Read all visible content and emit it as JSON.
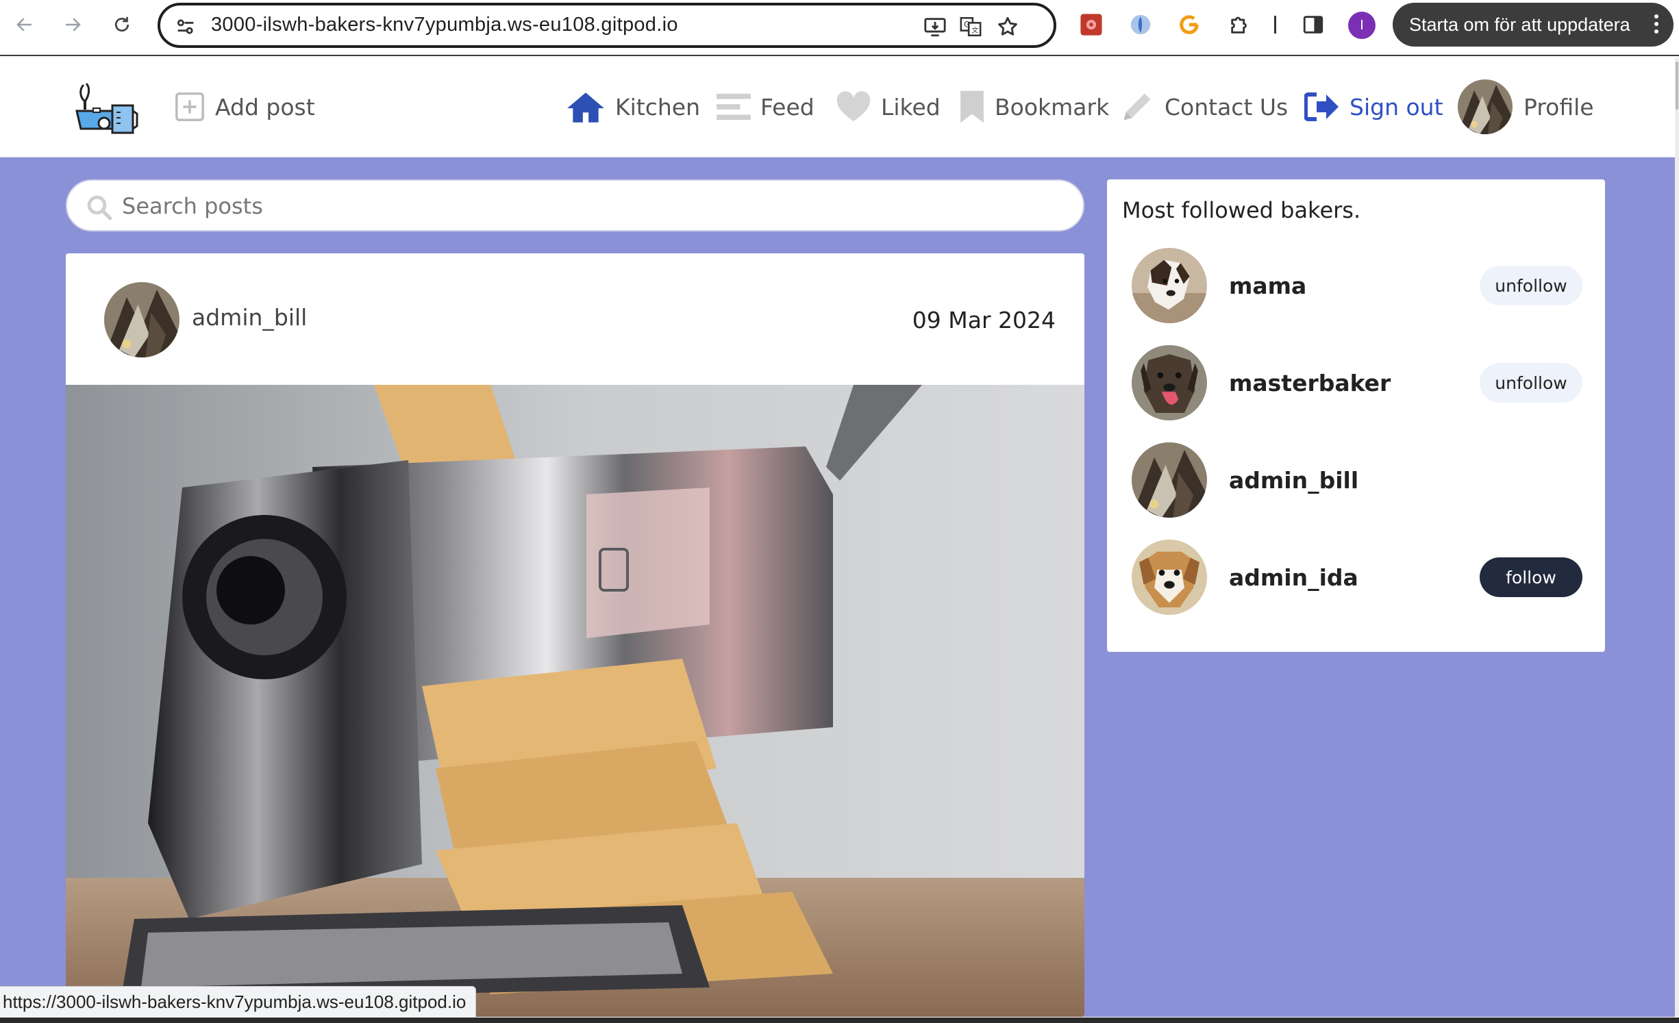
{
  "browser": {
    "url": "3000-ilswh-bakers-knv7ypumbja.ws-eu108.gitpod.io",
    "profile_initial": "I",
    "update_label": "Starta om för att uppdatera",
    "status_url": "https://3000-ilswh-bakers-knv7ypumbja.ws-eu108.gitpod.io"
  },
  "header": {
    "add_post": "Add post",
    "nav": {
      "kitchen": "Kitchen",
      "feed": "Feed",
      "liked": "Liked",
      "bookmark": "Bookmark",
      "contact": "Contact Us",
      "signout": "Sign out",
      "profile": "Profile"
    }
  },
  "search": {
    "placeholder": "Search posts"
  },
  "post": {
    "author": "admin_bill",
    "date": "09 Mar 2024"
  },
  "sidebar": {
    "title": "Most followed bakers.",
    "bakers": [
      {
        "name": "mama",
        "action": "unfollow"
      },
      {
        "name": "masterbaker",
        "action": "unfollow"
      },
      {
        "name": "admin_bill",
        "action": ""
      },
      {
        "name": "admin_ida",
        "action": "follow"
      }
    ]
  },
  "colors": {
    "page_bg": "#8b91d6",
    "signout_accent": "#2f4fc2",
    "kitchen_icon": "#2d50b4",
    "follow_btn": "#222a3d",
    "unfollow_btn": "#eef3fb"
  }
}
